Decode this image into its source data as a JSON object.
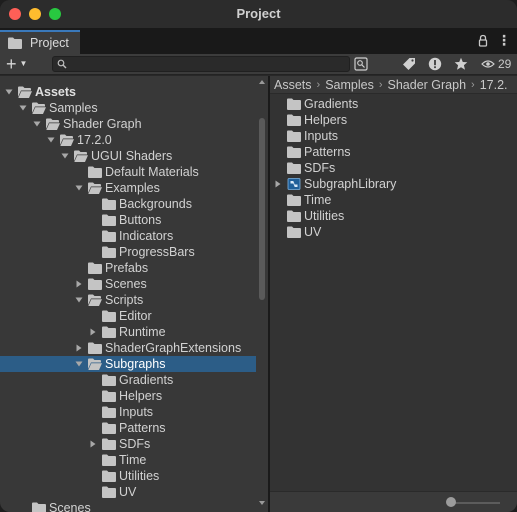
{
  "window": {
    "title": "Project"
  },
  "tab": {
    "label": "Project",
    "icon": "folder-icon"
  },
  "toolbar": {
    "add_label": "+",
    "search_placeholder": "",
    "visible_count": "29",
    "icons": [
      "search-by-type-icon",
      "label-icon",
      "error-filter-icon",
      "favorite-star-icon",
      "eye-icon"
    ]
  },
  "tree": [
    {
      "label": "Assets",
      "depth": 0,
      "arrow": "down",
      "bold": true
    },
    {
      "label": "Samples",
      "depth": 1,
      "arrow": "down"
    },
    {
      "label": "Shader Graph",
      "depth": 2,
      "arrow": "down"
    },
    {
      "label": "17.2.0",
      "depth": 3,
      "arrow": "down"
    },
    {
      "label": "UGUI Shaders",
      "depth": 4,
      "arrow": "down"
    },
    {
      "label": "Default Materials",
      "depth": 5,
      "arrow": "none"
    },
    {
      "label": "Examples",
      "depth": 5,
      "arrow": "down"
    },
    {
      "label": "Backgrounds",
      "depth": 6,
      "arrow": "none"
    },
    {
      "label": "Buttons",
      "depth": 6,
      "arrow": "none"
    },
    {
      "label": "Indicators",
      "depth": 6,
      "arrow": "none"
    },
    {
      "label": "ProgressBars",
      "depth": 6,
      "arrow": "none"
    },
    {
      "label": "Prefabs",
      "depth": 5,
      "arrow": "none"
    },
    {
      "label": "Scenes",
      "depth": 5,
      "arrow": "right"
    },
    {
      "label": "Scripts",
      "depth": 5,
      "arrow": "down"
    },
    {
      "label": "Editor",
      "depth": 6,
      "arrow": "none"
    },
    {
      "label": "Runtime",
      "depth": 6,
      "arrow": "right"
    },
    {
      "label": "ShaderGraphExtensions",
      "depth": 5,
      "arrow": "right"
    },
    {
      "label": "Subgraphs",
      "depth": 5,
      "arrow": "down",
      "selected": true
    },
    {
      "label": "Gradients",
      "depth": 6,
      "arrow": "none"
    },
    {
      "label": "Helpers",
      "depth": 6,
      "arrow": "none"
    },
    {
      "label": "Inputs",
      "depth": 6,
      "arrow": "none"
    },
    {
      "label": "Patterns",
      "depth": 6,
      "arrow": "none"
    },
    {
      "label": "SDFs",
      "depth": 6,
      "arrow": "right"
    },
    {
      "label": "Time",
      "depth": 6,
      "arrow": "none"
    },
    {
      "label": "Utilities",
      "depth": 6,
      "arrow": "none"
    },
    {
      "label": "UV",
      "depth": 6,
      "arrow": "none"
    },
    {
      "label": "Scenes",
      "depth": 1,
      "arrow": "none"
    }
  ],
  "breadcrumb": [
    "Assets",
    "Samples",
    "Shader Graph",
    "17.2."
  ],
  "contents": [
    {
      "label": "Gradients",
      "type": "folder"
    },
    {
      "label": "Helpers",
      "type": "folder"
    },
    {
      "label": "Inputs",
      "type": "folder"
    },
    {
      "label": "Patterns",
      "type": "folder"
    },
    {
      "label": "SDFs",
      "type": "folder"
    },
    {
      "label": "SubgraphLibrary",
      "type": "subgraph",
      "expandable": true
    },
    {
      "label": "Time",
      "type": "folder"
    },
    {
      "label": "Utilities",
      "type": "folder"
    },
    {
      "label": "UV",
      "type": "folder"
    }
  ],
  "colors": {
    "selection": "#2c5d87",
    "tab_accent": "#3a79bb",
    "close": "#fe5f57",
    "minimize": "#febc2e",
    "maximize": "#28c840"
  }
}
